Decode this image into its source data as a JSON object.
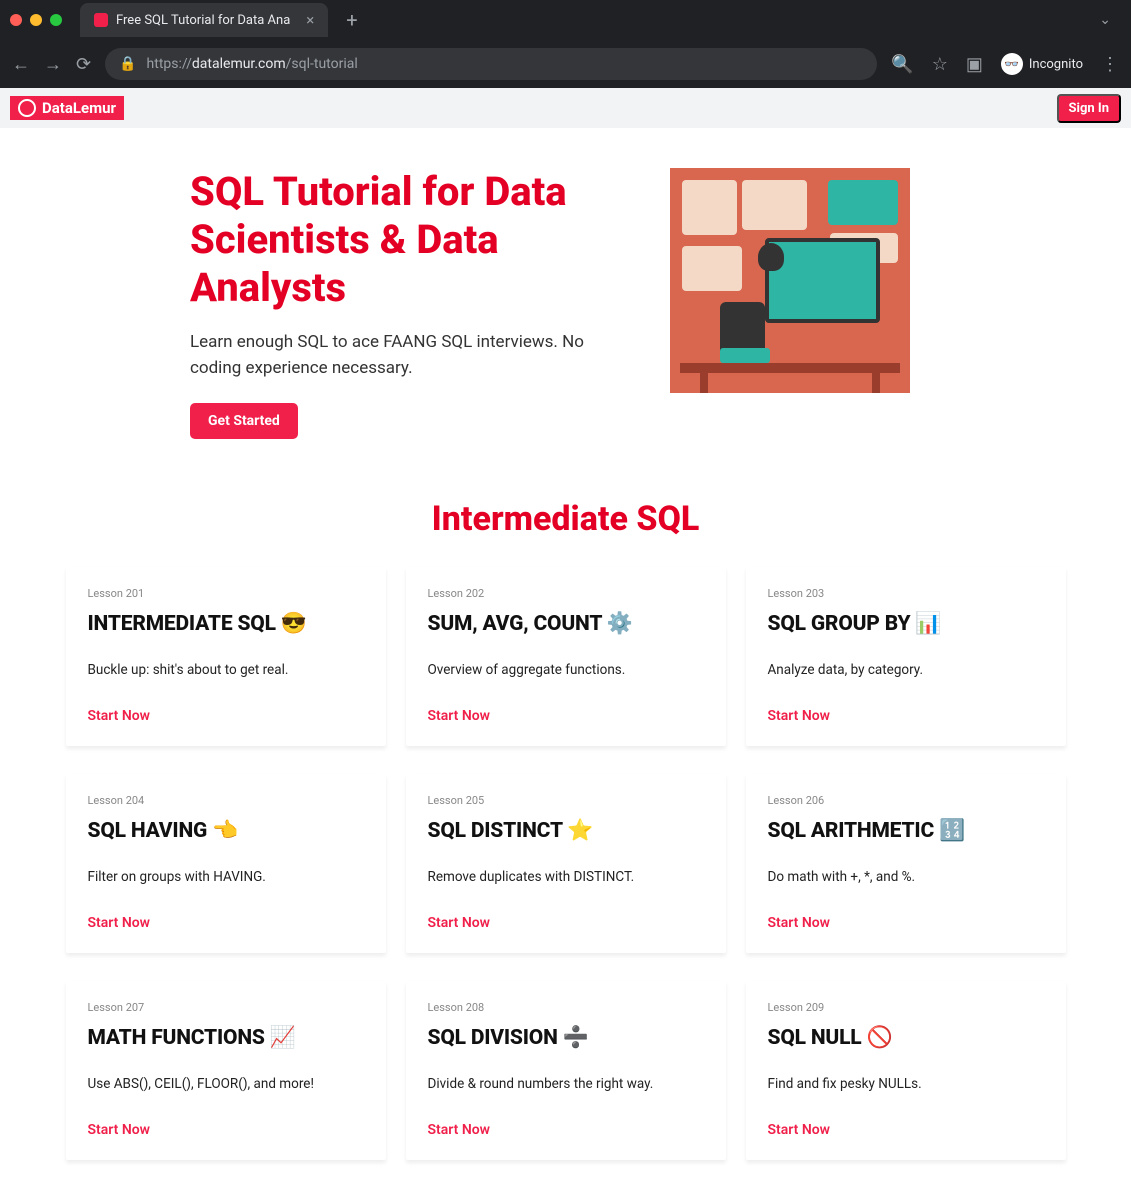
{
  "chrome": {
    "tab_title": "Free SQL Tutorial for Data Ana",
    "new_tab": "+",
    "dropdown_caret": "⌄",
    "back": "←",
    "forward": "→",
    "reload": "⟳",
    "lock": "🔒",
    "url_proto": "https://",
    "url_host": "datalemur.com",
    "url_path": "/sql-tutorial",
    "search_icon": "🔍",
    "star_icon": "☆",
    "panel_icon": "▣",
    "incognito_label": "Incognito",
    "menu_icon": "⋮"
  },
  "sitebar": {
    "brand": "DataLemur",
    "sign_in": "Sign In"
  },
  "hero": {
    "title": "SQL Tutorial for Data Scientists & Data Analysts",
    "subtitle": "Learn enough SQL to ace FAANG SQL interviews. No coding experience necessary.",
    "cta": "Get Started"
  },
  "section": {
    "title": "Intermediate SQL"
  },
  "lessons": [
    {
      "num": "Lesson 201",
      "title": "INTERMEDIATE SQL 😎",
      "desc": "Buckle up: shit's about to get real.",
      "start": "Start Now"
    },
    {
      "num": "Lesson 202",
      "title": "SUM, AVG, COUNT ⚙️",
      "desc": "Overview of aggregate functions.",
      "start": "Start Now"
    },
    {
      "num": "Lesson 203",
      "title": "SQL GROUP BY 📊",
      "desc": "Analyze data, by category.",
      "start": "Start Now"
    },
    {
      "num": "Lesson 204",
      "title": "SQL HAVING 👈",
      "desc": "Filter on groups with HAVING.",
      "start": "Start Now"
    },
    {
      "num": "Lesson 205",
      "title": "SQL DISTINCT ⭐",
      "desc": "Remove duplicates with DISTINCT.",
      "start": "Start Now"
    },
    {
      "num": "Lesson 206",
      "title": "SQL ARITHMETIC 🔢",
      "desc": "Do math with +, *, and %.",
      "start": "Start Now"
    },
    {
      "num": "Lesson 207",
      "title": "MATH FUNCTIONS 📈",
      "desc": "Use ABS(), CEIL(), FLOOR(), and more!",
      "start": "Start Now"
    },
    {
      "num": "Lesson 208",
      "title": "SQL DIVISION ➗",
      "desc": "Divide & round numbers the right way.",
      "start": "Start Now"
    },
    {
      "num": "Lesson 209",
      "title": "SQL NULL 🚫",
      "desc": "Find and fix pesky NULLs.",
      "start": "Start Now"
    }
  ]
}
